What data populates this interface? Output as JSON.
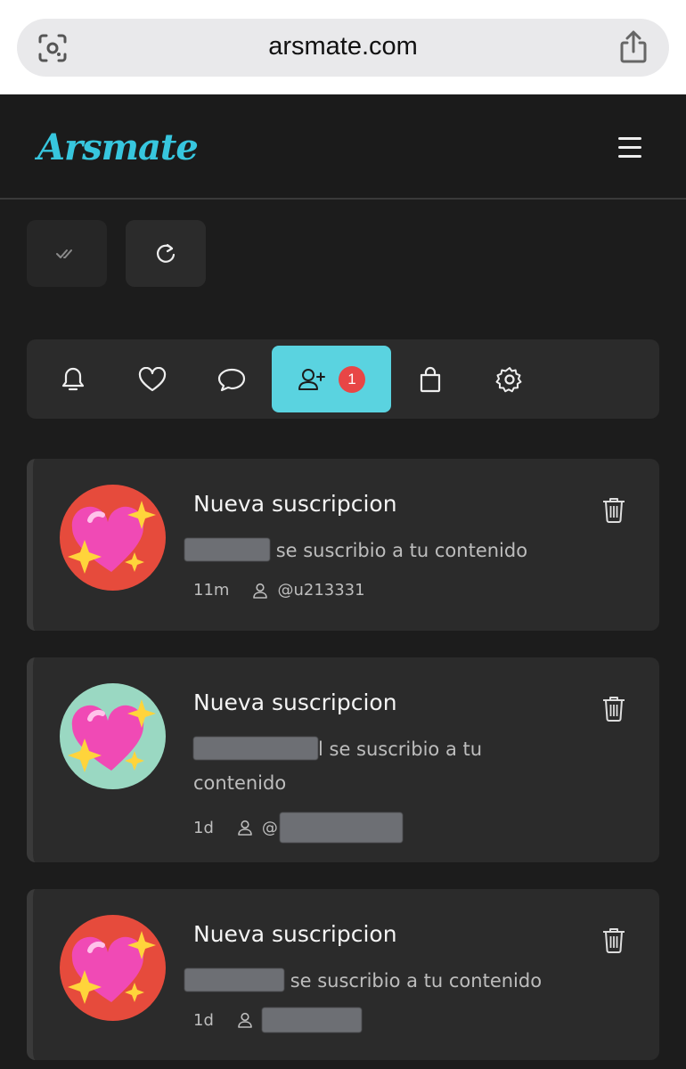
{
  "browser": {
    "url": "arsmate.com"
  },
  "header": {
    "logo_text": "Arsmate"
  },
  "colors": {
    "accent": "#5ad3e0",
    "logo": "#37c6de",
    "badge": "#e84646",
    "background": "#1c1c1c",
    "card": "#2b2b2b"
  },
  "actions": {
    "mark_read_icon": "double-check-icon",
    "refresh_icon": "refresh-icon"
  },
  "tabs": [
    {
      "icon": "bell-icon"
    },
    {
      "icon": "heart-icon"
    },
    {
      "icon": "chat-bubble-icon"
    },
    {
      "icon": "user-plus-icon",
      "badge": "1",
      "active": true
    },
    {
      "icon": "shopping-bag-icon"
    },
    {
      "icon": "gear-icon"
    }
  ],
  "notifications": [
    {
      "title": "Nueva suscripcion",
      "text": "se suscribio a tu contenido",
      "time": "11m",
      "username": "@u213331",
      "avatar": "sparkling-heart"
    },
    {
      "title": "Nueva suscripcion",
      "text_partial": "l se suscribio a tu",
      "text_rest": "contenido",
      "time": "1d",
      "username_prefix": "@",
      "avatar": "sparkling-heart"
    },
    {
      "title": "Nueva suscripcion",
      "text": "se suscribio a tu contenido",
      "time": "1d",
      "avatar": "sparkling-heart"
    }
  ]
}
